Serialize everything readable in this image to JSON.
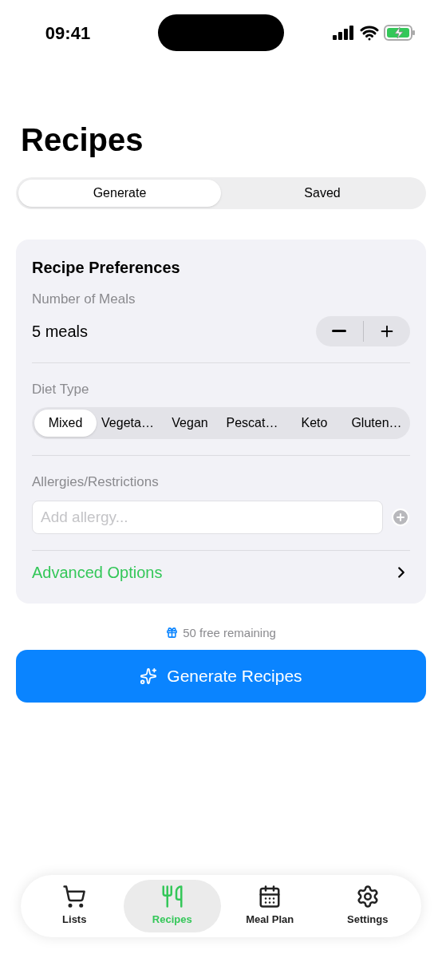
{
  "status_bar": {
    "time": "09:41"
  },
  "title": "Recipes",
  "segments": [
    {
      "label": "Generate",
      "selected": true
    },
    {
      "label": "Saved",
      "selected": false
    }
  ],
  "preferences": {
    "title": "Recipe Preferences",
    "meals_label": "Number of Meals",
    "meals_value": "5 meals",
    "diet_label": "Diet Type",
    "diets": [
      {
        "label": "Mixed",
        "selected": true
      },
      {
        "label": "Vegeta…",
        "selected": false
      },
      {
        "label": "Vegan",
        "selected": false
      },
      {
        "label": "Pescat…",
        "selected": false
      },
      {
        "label": "Keto",
        "selected": false
      },
      {
        "label": "Gluten…",
        "selected": false
      }
    ],
    "allergies_label": "Allergies/Restrictions",
    "allergy_placeholder": "Add allergy...",
    "advanced": "Advanced Options"
  },
  "free_note": "50 free remaining",
  "generate_button": "Generate Recipes",
  "tab_bar": [
    {
      "label": "Lists",
      "kind": "cart",
      "selected": false
    },
    {
      "label": "Recipes",
      "kind": "utensils",
      "selected": true
    },
    {
      "label": "Meal Plan",
      "kind": "calendar",
      "selected": false
    },
    {
      "label": "Settings",
      "kind": "gear",
      "selected": false
    }
  ]
}
